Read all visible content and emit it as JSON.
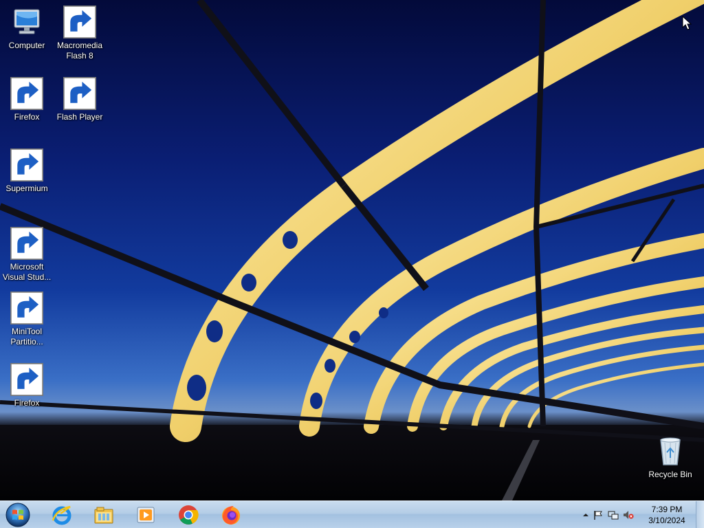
{
  "desktop": {
    "icons": [
      {
        "label": "Computer",
        "icon": "computer-icon"
      },
      {
        "label": "Macromedia Flash 8",
        "icon": "macromedia-flash-icon"
      },
      {
        "label": "Firefox",
        "icon": "firefox-icon"
      },
      {
        "label": "Flash Player",
        "icon": "flash-player-icon"
      },
      {
        "label": "Supermium",
        "icon": "supermium-icon"
      },
      {
        "label": "Microsoft Visual Stud...",
        "icon": "visual-studio-icon"
      },
      {
        "label": "MiniTool Partitio...",
        "icon": "minitool-icon"
      },
      {
        "label": "Firefox",
        "icon": "firefox-icon"
      },
      {
        "label": "Recycle Bin",
        "icon": "recycle-bin-icon"
      }
    ]
  },
  "taskbar": {
    "start": {
      "icon": "windows-start-icon"
    },
    "pinned": [
      {
        "name": "Internet Explorer",
        "icon": "internet-explorer-icon"
      },
      {
        "name": "Windows Explorer",
        "icon": "file-explorer-icon"
      },
      {
        "name": "Windows Media Player",
        "icon": "media-player-icon"
      },
      {
        "name": "Google Chrome",
        "icon": "chrome-icon"
      },
      {
        "name": "Firefox",
        "icon": "firefox-icon"
      }
    ],
    "tray": {
      "icons": [
        "show-hidden-icons-arrow",
        "action-center-flag-icon",
        "network-icon",
        "volume-muted-icon"
      ],
      "time": "7:39 PM",
      "date": "3/10/2024"
    }
  },
  "colors": {
    "sky_top": "#030a3a",
    "sky_mid": "#123b9e",
    "bridge_gold": "#f3d77a",
    "taskbar": "#b4cde6"
  }
}
